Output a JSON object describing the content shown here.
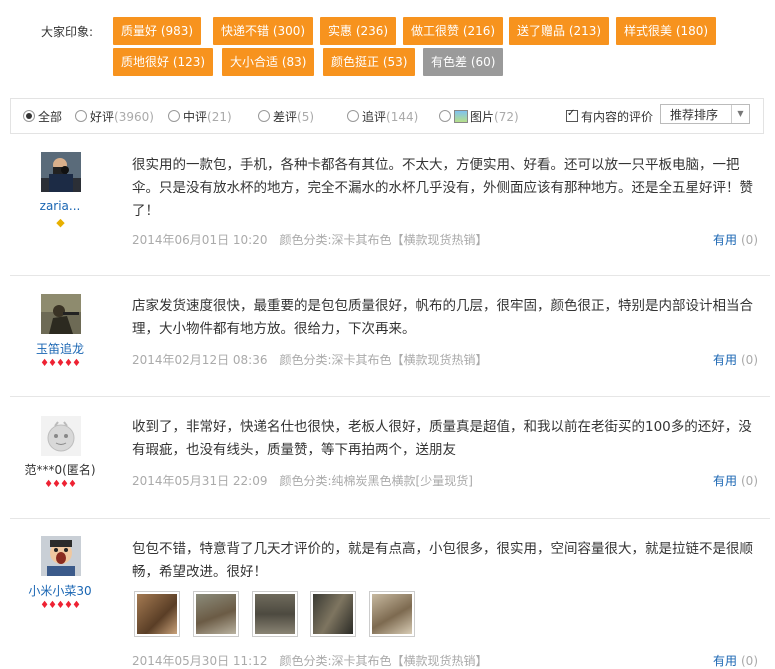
{
  "impression": {
    "label": "大家印象:",
    "tags": [
      {
        "text": "质量好 (983)"
      },
      {
        "text": "快递不错 (300)"
      },
      {
        "text": "实惠 (236)"
      },
      {
        "text": "做工很赞 (216)"
      },
      {
        "text": "送了赠品 (213)"
      },
      {
        "text": "样式很美 (180)"
      },
      {
        "text": "质地很好 (123)"
      },
      {
        "text": "大小合适 (83)"
      },
      {
        "text": "颜色挺正 (53)"
      },
      {
        "text": "有色差 (60)"
      }
    ]
  },
  "filters": {
    "all": "全部",
    "good": "好评",
    "good_count": "(3960)",
    "mid": "中评",
    "mid_count": "(21)",
    "bad": "差评",
    "bad_count": "(5)",
    "append": "追评",
    "append_count": "(144)",
    "pic": "图片",
    "pic_count": "(72)",
    "has_content": "有内容的评价",
    "sort": "推荐排序"
  },
  "reviews": [
    {
      "user": "zaria...",
      "content": "很实用的一款包，手机，各种卡都各有其位。不太大，方便实用、好看。还可以放一只平板电脑，一把伞。只是没有放水杯的地方，完全不漏水的水杯几乎没有，外侧面应该有那种地方。还是全五星好评！赞了！",
      "date": "2014年06月01日 10:20",
      "category": "颜色分类:深卡其布色【横款现货热销】",
      "useful": "有用",
      "useful_count": "(0)"
    },
    {
      "user": "玉笛追龙",
      "content": "店家发货速度很快，最重要的是包包质量很好，帆布的几层，很牢固，颜色很正，特别是内部设计相当合理，大小物件都有地方放。很给力，下次再来。",
      "date": "2014年02月12日 08:36",
      "category": "颜色分类:深卡其布色【横款现货热销】",
      "useful": "有用",
      "useful_count": "(0)"
    },
    {
      "user": "范***0(匿名)",
      "content": "收到了，非常好，快递名仕也很快，老板人很好，质量真是超值，和我以前在老街买的100多的还好，没有瑕疵，也没有线头，质量赞，等下再拍两个，送朋友",
      "date": "2014年05月31日 22:09",
      "category": "颜色分类:纯棉炭黑色横款[少量现货]",
      "useful": "有用",
      "useful_count": "(0)"
    },
    {
      "user": "小米小菜30",
      "content": "包包不错，特意背了几天才评价的，就是有点高，小包很多，很实用，空间容量很大，就是拉链不是很顺畅，希望改进。很好！",
      "date": "2014年05月30日 11:12",
      "category": "颜色分类:深卡其布色【横款现货热销】",
      "useful": "有用",
      "useful_count": "(0)"
    }
  ],
  "colors": {
    "tag": "#f7931e",
    "tag_gray": "#9a9a9a",
    "link": "#1a66b3"
  }
}
